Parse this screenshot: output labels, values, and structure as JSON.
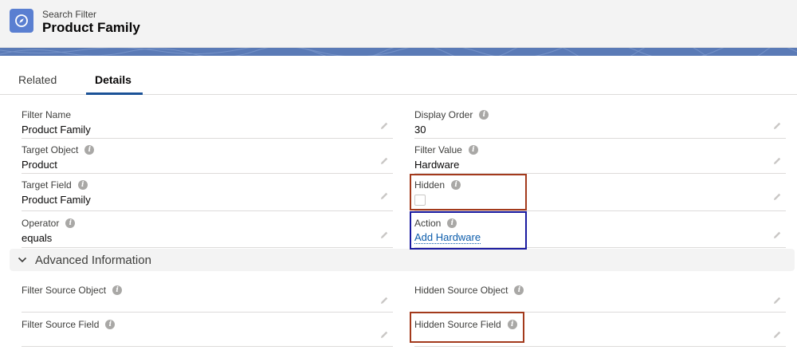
{
  "header": {
    "object_label": "Search Filter",
    "record_title": "Product Family",
    "icon": "compass-icon"
  },
  "tabs": [
    {
      "label": "Related",
      "active": false
    },
    {
      "label": "Details",
      "active": true
    }
  ],
  "fields": {
    "filter_name": {
      "label": "Filter Name",
      "value": "Product Family",
      "has_info": false
    },
    "display_order": {
      "label": "Display Order",
      "value": "30",
      "has_info": true
    },
    "target_object": {
      "label": "Target Object",
      "value": "Product",
      "has_info": true
    },
    "filter_value": {
      "label": "Filter Value",
      "value": "Hardware",
      "has_info": true
    },
    "target_field": {
      "label": "Target Field",
      "value": "Product Family",
      "has_info": true
    },
    "hidden": {
      "label": "Hidden",
      "checked": false,
      "has_info": true
    },
    "operator": {
      "label": "Operator",
      "value": "equals",
      "has_info": true
    },
    "action": {
      "label": "Action",
      "value": "Add Hardware",
      "has_info": true,
      "is_link": true
    }
  },
  "advanced_section": {
    "title": "Advanced Information",
    "expanded": true,
    "fields": {
      "filter_source_object": {
        "label": "Filter Source Object",
        "value": "",
        "has_info": true
      },
      "hidden_source_object": {
        "label": "Hidden Source Object",
        "value": "",
        "has_info": true
      },
      "filter_source_field": {
        "label": "Filter Source Field",
        "value": "",
        "has_info": true
      },
      "hidden_source_field": {
        "label": "Hidden Source Field",
        "value": "",
        "has_info": true
      }
    }
  },
  "colors": {
    "brand_icon": "#5a7fd1",
    "banner": "#5a7ab6",
    "active_tab": "#1b5297",
    "link": "#0b5cab",
    "highlight_red": "#a33a1c",
    "highlight_blue": "#1a1aa0"
  }
}
